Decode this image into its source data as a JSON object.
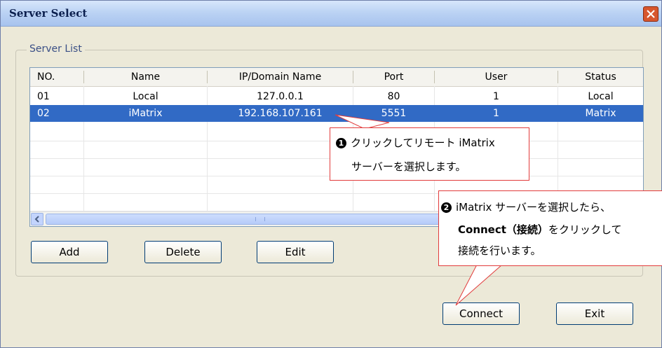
{
  "window": {
    "title": "Server Select"
  },
  "server_list": {
    "label": "Server List",
    "columns": [
      "NO.",
      "Name",
      "IP/Domain Name",
      "Port",
      "User",
      "Status"
    ],
    "rows": [
      [
        "01",
        "Local",
        "127.0.0.1",
        "80",
        "1",
        "Local"
      ],
      [
        "02",
        "iMatrix",
        "192.168.107.161",
        "5551",
        "1",
        "Matrix"
      ]
    ],
    "selected_row": 1
  },
  "buttons": {
    "add": "Add",
    "delete": "Delete",
    "edit": "Edit",
    "connect": "Connect",
    "exit": "Exit"
  },
  "callouts": {
    "one": {
      "badge": "1",
      "line1": "クリックしてリモート iMatrix",
      "line2": "サーバーを選択します。"
    },
    "two": {
      "badge": "2",
      "line1": "iMatrix サーバーを選択したら、",
      "line2_bold": "Connect（接続）",
      "line2_rest": "をクリックして",
      "line3": "接続を行います。"
    }
  },
  "colors": {
    "selection": "#316ac5",
    "callout_border": "#e23b3b",
    "close_button": "#d7572f"
  }
}
